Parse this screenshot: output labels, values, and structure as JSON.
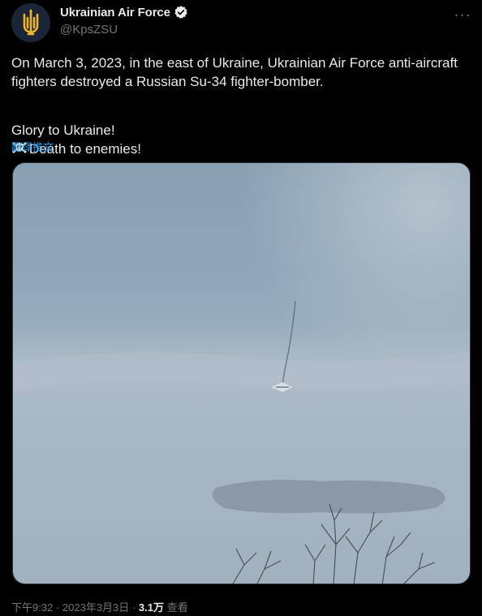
{
  "author": {
    "display_name": "Ukrainian Air Force",
    "handle": "@KpsZSU",
    "verified": true,
    "avatar_icon": "trident-emblem-icon"
  },
  "more_button": {
    "icon": "more-horizontal-icon",
    "glyph": "···"
  },
  "tweet": {
    "text_line1": "On March 3, 2023, in the east of Ukraine, Ukrainian Air Force anti-aircraft fighters destroyed a Russian Su-34 fighter-bomber.",
    "glory": "Glory to Ukraine!",
    "death": "Death to enemies!",
    "translate_label": "翻译推文"
  },
  "media": {
    "type": "video-frame",
    "description_icon": "sky-with-aircraft-image"
  },
  "meta": {
    "time": "下午9:32",
    "separator": "·",
    "date": "2023年3月3日",
    "views_count": "3.1万",
    "views_label": "查看"
  },
  "colors": {
    "background": "#000000",
    "text_primary": "#e7e9ea",
    "text_secondary": "#71767b",
    "link": "#1d9bf0",
    "verified_badge": "#e7e9ea"
  }
}
